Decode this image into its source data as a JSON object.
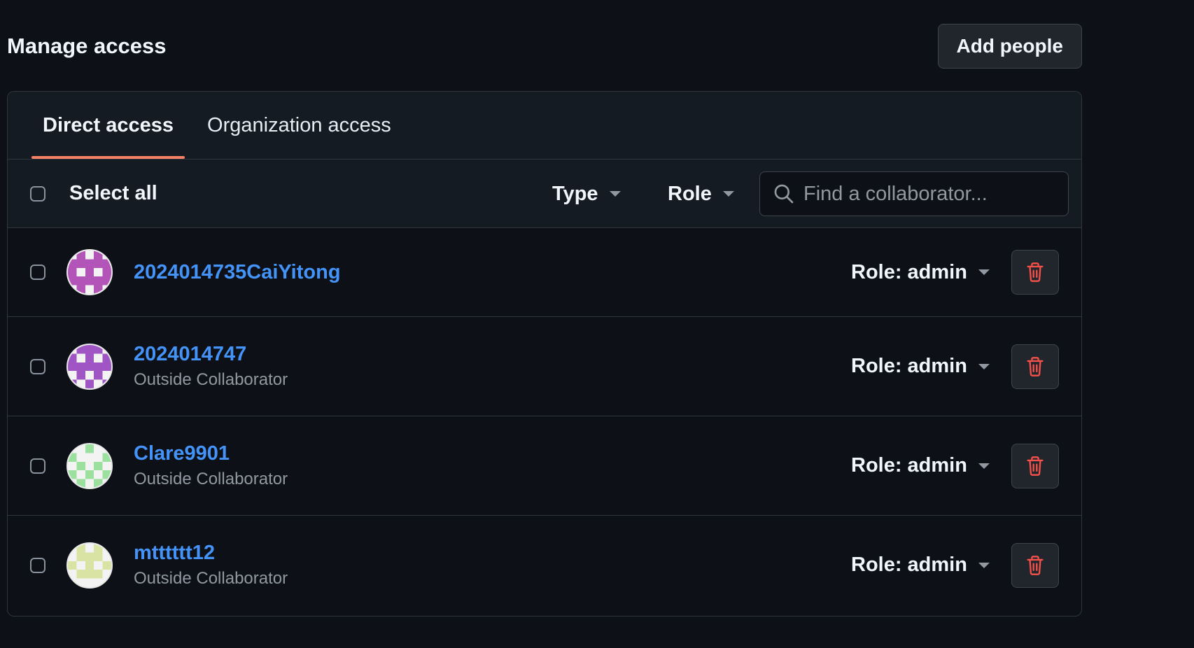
{
  "header": {
    "title": "Manage access",
    "add_people_label": "Add people"
  },
  "tabs": [
    {
      "label": "Direct access",
      "active": true
    },
    {
      "label": "Organization access",
      "active": false
    }
  ],
  "toolbar": {
    "select_all_label": "Select all",
    "type_filter_label": "Type",
    "role_filter_label": "Role",
    "search_placeholder": "Find a collaborator..."
  },
  "collaborators": [
    {
      "username": "2024014735CaiYitong",
      "type": "",
      "role": "Role: admin",
      "avatar_color": "#b354b8"
    },
    {
      "username": "2024014747",
      "type": "Outside Collaborator",
      "role": "Role: admin",
      "avatar_color": "#a055c4"
    },
    {
      "username": "Clare9901",
      "type": "Outside Collaborator",
      "role": "Role: admin",
      "avatar_color": "#9be09f"
    },
    {
      "username": "mtttttt12",
      "type": "Outside Collaborator",
      "role": "Role: admin",
      "avatar_color": "#d9e3a4"
    }
  ],
  "colors": {
    "background": "#0d1117",
    "accent_tab_underline": "#f78166",
    "link": "#4493f8",
    "danger": "#f85149"
  },
  "icons": {
    "search": "search-icon",
    "caret": "caret-down-icon",
    "remove": "trash-icon"
  }
}
